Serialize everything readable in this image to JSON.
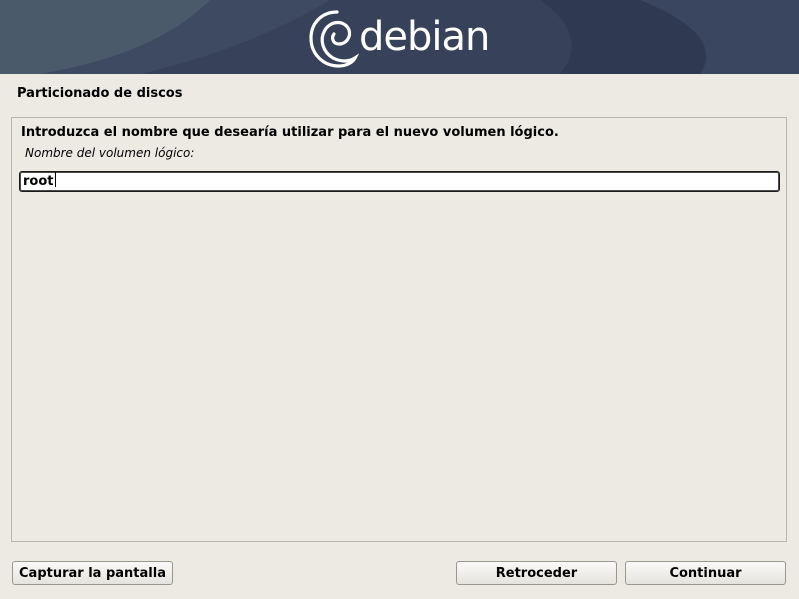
{
  "header": {
    "brand": "debian",
    "colors": {
      "banner": "#37425a",
      "logo": "#ffffff"
    }
  },
  "page": {
    "title": "Particionado de discos"
  },
  "form": {
    "prompt": "Introduzca el nombre que desearía utilizar para el nuevo volumen lógico.",
    "field_label": "Nombre del volumen lógico:",
    "input_value": "root"
  },
  "buttons": {
    "screenshot": "Capturar la pantalla",
    "back": "Retroceder",
    "continue": "Continuar"
  }
}
